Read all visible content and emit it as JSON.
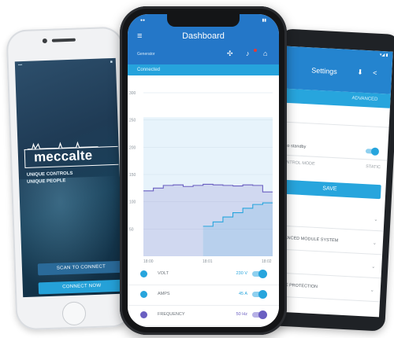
{
  "left_phone": {
    "logo": "meccalte",
    "taglines": [
      "UNIQUE CONTROLS",
      "UNIQUE PEOPLE"
    ],
    "buttons": [
      "SCAN TO CONNECT",
      "CONNECT NOW"
    ]
  },
  "center_phone": {
    "title": "Dashboard",
    "subtitle": "Generator",
    "status": "Connected",
    "chart_data": {
      "type": "line",
      "ylim": [
        0,
        300
      ],
      "y_ticks": [
        "300",
        "250",
        "200",
        "150",
        "100",
        "50"
      ],
      "x_ticks": [
        "18:00",
        "18:01",
        "18:02"
      ],
      "series": [
        {
          "color": "#6a5fc1",
          "values": [
            120,
            125,
            130,
            131,
            128,
            130,
            132,
            131,
            130,
            129,
            131,
            130,
            118,
            118
          ]
        },
        {
          "color": "#27a5dd",
          "values": [
            null,
            null,
            null,
            null,
            null,
            null,
            55,
            63,
            72,
            80,
            88,
            95,
            98,
            98
          ]
        }
      ]
    },
    "items": [
      {
        "label": "VOLT",
        "value": "230 V",
        "color": "#27a5dd"
      },
      {
        "label": "AMPS",
        "value": "45 A",
        "color": "#27a5dd"
      },
      {
        "label": "FREQUENCY",
        "value": "50 Hz",
        "color": "#6a5fc1"
      }
    ]
  },
  "right_phone": {
    "title": "Settings",
    "tab": "ADVANCED",
    "rows": [
      {
        "label": "Auto standby"
      },
      {
        "label": "CONTROL MODE",
        "value": "STATIC"
      }
    ],
    "save_label": "SAVE",
    "menu": [
      "",
      "ADVANCED MODULE SYSTEM",
      "",
      "PHASE PROTECTION"
    ]
  },
  "colors": {
    "brand_blue": "#2477c8",
    "accent_cyan": "#27a5dd",
    "purple": "#6a5fc1"
  }
}
